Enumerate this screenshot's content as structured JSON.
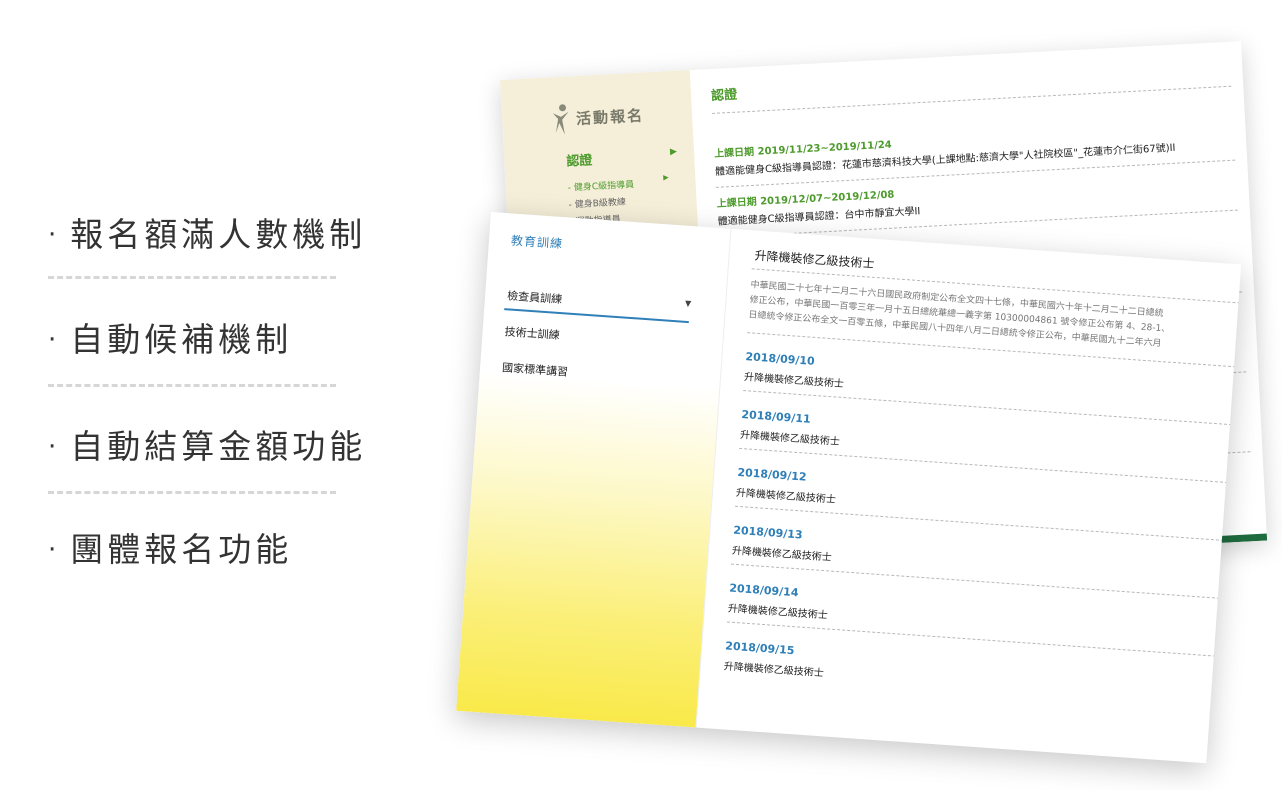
{
  "features": [
    {
      "label": "報名額滿人數機制"
    },
    {
      "label": "自動候補機制"
    },
    {
      "label": "自動結算金額功能"
    },
    {
      "label": "團體報名功能"
    }
  ],
  "back_card": {
    "logo_text": "活動報名",
    "nav_main": "認證",
    "sub_items": [
      "健身C級指導員",
      "健身B級教練",
      "運動指導員"
    ],
    "main_title": "認證",
    "entries": [
      {
        "date_line": "上課日期  2019/11/23~2019/11/24",
        "desc": "體適能健身C級指導員認證：花蓮市慈濟科技大學(上課地點:慈濟大學\"人社院校區\"_花蓮市介仁街67號)II"
      },
      {
        "date_line": "上課日期  2019/12/07~2019/12/08",
        "desc": "體適能健身C級指導員認證：台中市靜宜大學II"
      }
    ],
    "accent_color": "#4d9b2c",
    "bar_color": "#1f6b3e"
  },
  "front_card": {
    "side_title": "教育訓練",
    "menu": [
      "檢查員訓練",
      "技術士訓練",
      "國家標準講習"
    ],
    "main_title": "升降機裝修乙級技術士",
    "intro_lines": [
      "中華民國二十七年十二月二十六日國民政府制定公布全文四十七條，中華民國六十年十二月二十二日總統",
      "修正公布，中華民國一百零三年一月十五日總統華總一義字第 10300004861 號令修正公布第 4、28-1、",
      "日總統令修正公布全文一百零五條，中華民國八十四年八月二日總統令修正公布，中華民國九十二年六月"
    ],
    "entries": [
      {
        "date": "2018/09/10",
        "name": "升降機裝修乙級技術士"
      },
      {
        "date": "2018/09/11",
        "name": "升降機裝修乙級技術士"
      },
      {
        "date": "2018/09/12",
        "name": "升降機裝修乙級技術士"
      },
      {
        "date": "2018/09/13",
        "name": "升降機裝修乙級技術士"
      },
      {
        "date": "2018/09/14",
        "name": "升降機裝修乙級技術士"
      },
      {
        "date": "2018/09/15",
        "name": "升降機裝修乙級技術士"
      }
    ],
    "accent_color": "#2f7fb8"
  }
}
